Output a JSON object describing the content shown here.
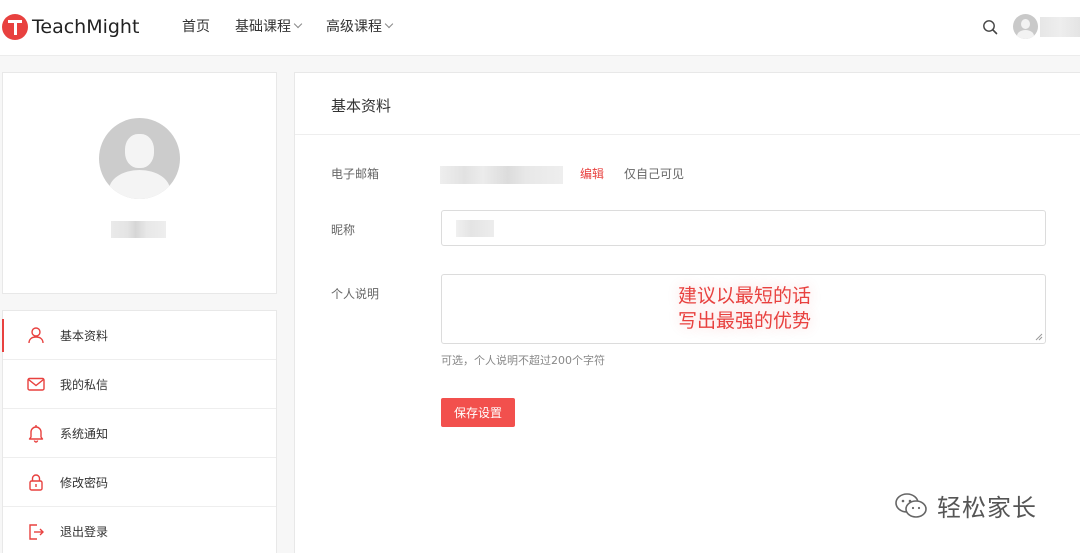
{
  "brand": {
    "name": "TeachMight",
    "accent": "#e8413f"
  },
  "nav": {
    "items": [
      {
        "label": "首页",
        "dropdown": false
      },
      {
        "label": "基础课程",
        "dropdown": true
      },
      {
        "label": "高级课程",
        "dropdown": true
      }
    ]
  },
  "sidebar": {
    "items": [
      {
        "label": "基本资料",
        "icon": "user-icon",
        "active": true
      },
      {
        "label": "我的私信",
        "icon": "mail-icon",
        "active": false
      },
      {
        "label": "系统通知",
        "icon": "bell-icon",
        "active": false
      },
      {
        "label": "修改密码",
        "icon": "lock-icon",
        "active": false
      },
      {
        "label": "退出登录",
        "icon": "logout-icon",
        "active": false
      }
    ]
  },
  "main": {
    "title": "基本资料",
    "email": {
      "label": "电子邮箱",
      "edit_label": "编辑",
      "visibility": "仅自己可见"
    },
    "nickname": {
      "label": "昵称"
    },
    "bio": {
      "label": "个人说明",
      "hint": "可选，个人说明不超过200个字符"
    },
    "save_label": "保存设置"
  },
  "overlay": {
    "line1": "建议以最短的话",
    "line2": "写出最强的优势"
  },
  "watermark": {
    "text": "轻松家长"
  }
}
